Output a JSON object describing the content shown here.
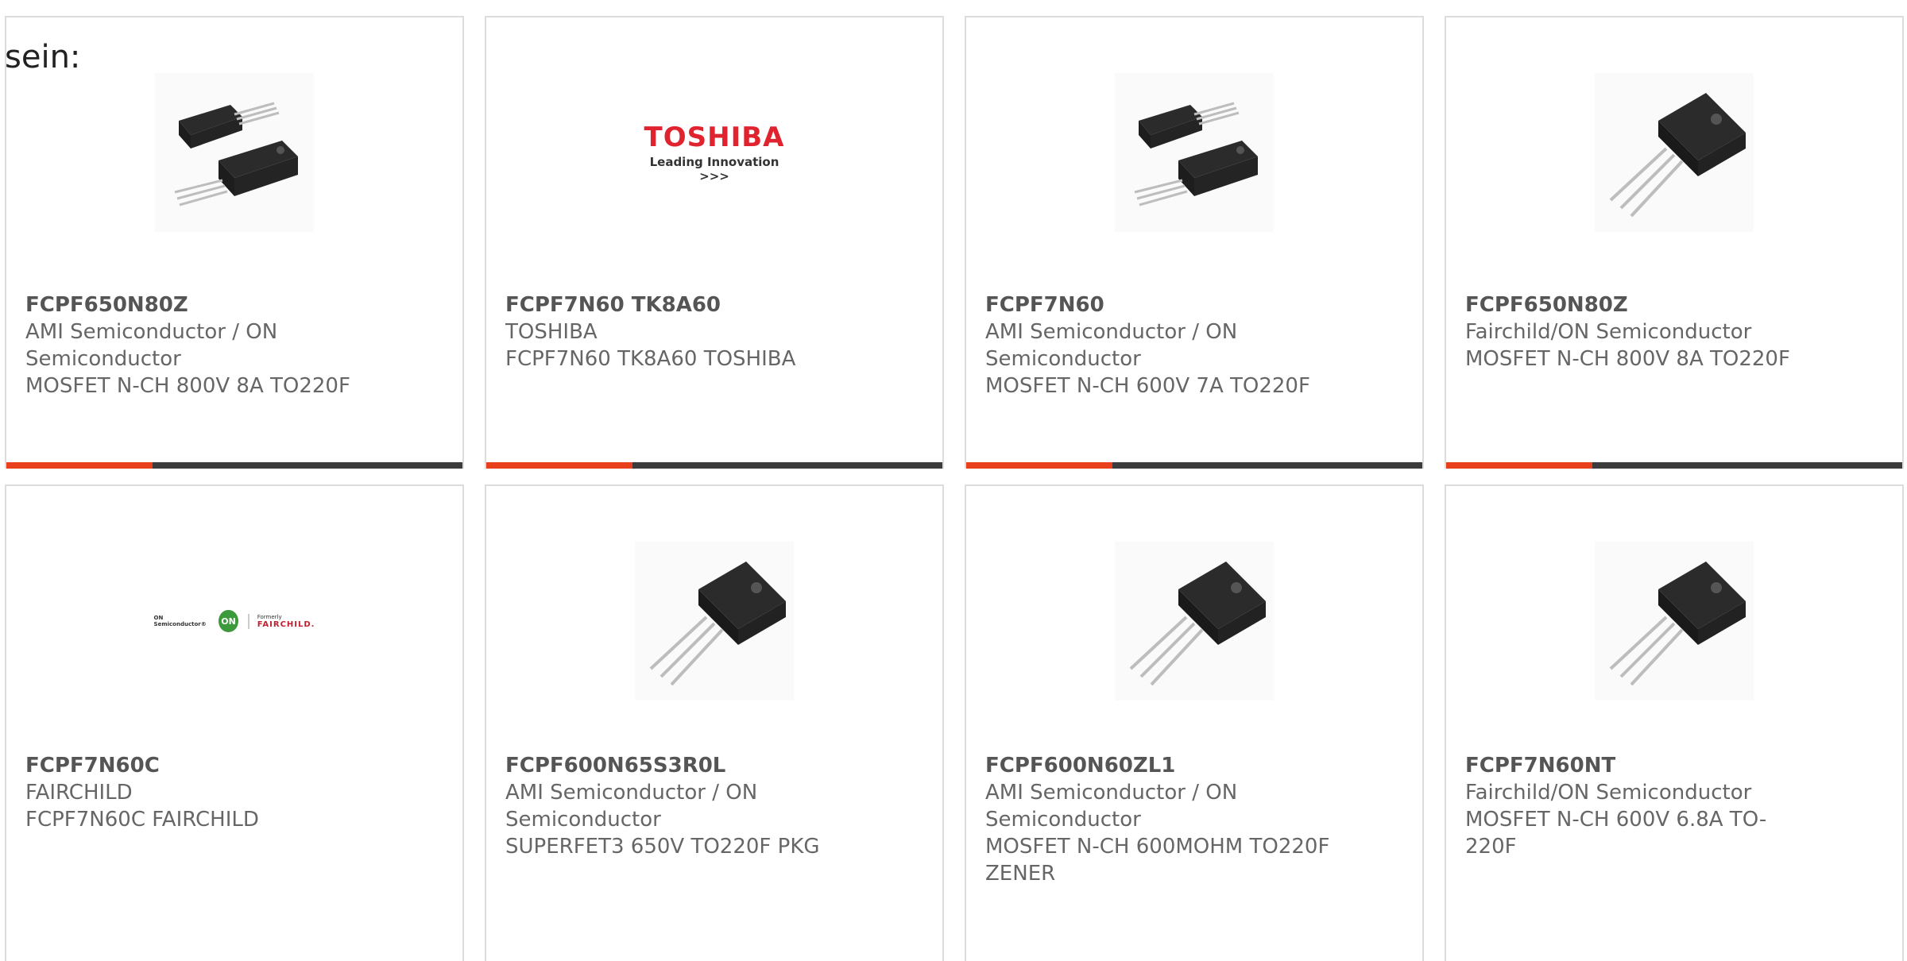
{
  "lead_text": "sein:",
  "colors": {
    "accent": "#e8401c",
    "bar": "#3c3c3c",
    "card_border": "#dcdcdc"
  },
  "cards": [
    {
      "part": "FCPF650N80Z",
      "lines": [
        "AMI Semiconductor / ON",
        "Semiconductor",
        "MOSFET N-CH 800V 8A TO220F"
      ],
      "image": "transistor-pair-icon"
    },
    {
      "part": "FCPF7N60 TK8A60",
      "lines": [
        "TOSHIBA",
        "FCPF7N60 TK8A60 TOSHIBA"
      ],
      "image": "toshiba-logo",
      "logo_word": "TOSHIBA",
      "logo_tag": "Leading Innovation >>>"
    },
    {
      "part": "FCPF7N60",
      "lines": [
        "AMI Semiconductor / ON",
        "Semiconductor",
        "MOSFET N-CH 600V 7A TO220F"
      ],
      "image": "transistor-pair-icon"
    },
    {
      "part": "FCPF650N80Z",
      "lines": [
        "Fairchild/ON Semiconductor",
        "MOSFET N-CH 800V 8A TO220F"
      ],
      "image": "transistor-single-icon"
    },
    {
      "part": "FCPF7N60C",
      "lines": [
        "FAIRCHILD",
        "FCPF7N60C FAIRCHILD"
      ],
      "image": "on-fairchild-logo",
      "logo_on_text": "ON Semiconductor®",
      "logo_on_badge": "ON",
      "logo_formerly": "Formerly",
      "logo_fairchild": "FAIRCHILD."
    },
    {
      "part": "FCPF600N65S3R0L",
      "lines": [
        "AMI Semiconductor / ON",
        "Semiconductor",
        "SUPERFET3 650V TO220F PKG"
      ],
      "image": "transistor-single-icon"
    },
    {
      "part": "FCPF600N60ZL1",
      "lines": [
        "AMI Semiconductor / ON",
        "Semiconductor",
        "MOSFET N-CH 600MOHM TO220F",
        "ZENER"
      ],
      "image": "transistor-single-icon"
    },
    {
      "part": "FCPF7N60NT",
      "lines": [
        "Fairchild/ON Semiconductor",
        "MOSFET N-CH 600V 6.8A TO-",
        "220F"
      ],
      "image": "transistor-single-icon"
    }
  ]
}
